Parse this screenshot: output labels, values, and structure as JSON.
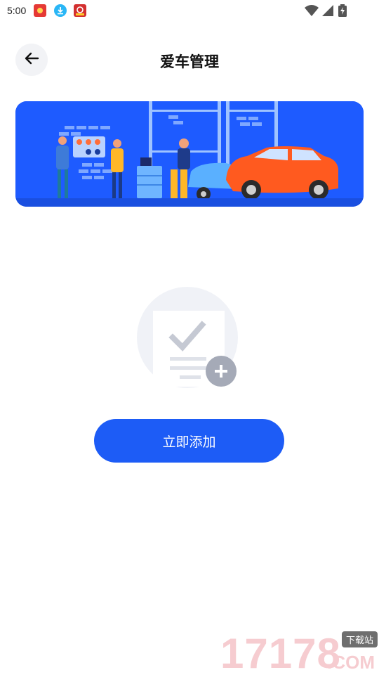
{
  "status_bar": {
    "time": "5:00",
    "app_icons": [
      "red-envelope-icon",
      "download-icon",
      "shop-icon"
    ],
    "right_icons": [
      "wifi-icon",
      "cellular-signal-icon",
      "battery-charging-icon"
    ]
  },
  "header": {
    "title": "爱车管理",
    "back_icon": "arrow-left-icon"
  },
  "banner": {
    "description_icon": "car-repair-illustration"
  },
  "empty_state": {
    "icon": "add-document-icon"
  },
  "actions": {
    "add_label": "立即添加"
  },
  "watermark": {
    "digits": "17178",
    "badge": "下载站",
    "domain": ".COM"
  },
  "colors": {
    "primary": "#1d5cf6",
    "banner_bg": "#1e5bff",
    "back_bg": "#f2f3f6",
    "illustration_bg": "#f0f2f7"
  }
}
